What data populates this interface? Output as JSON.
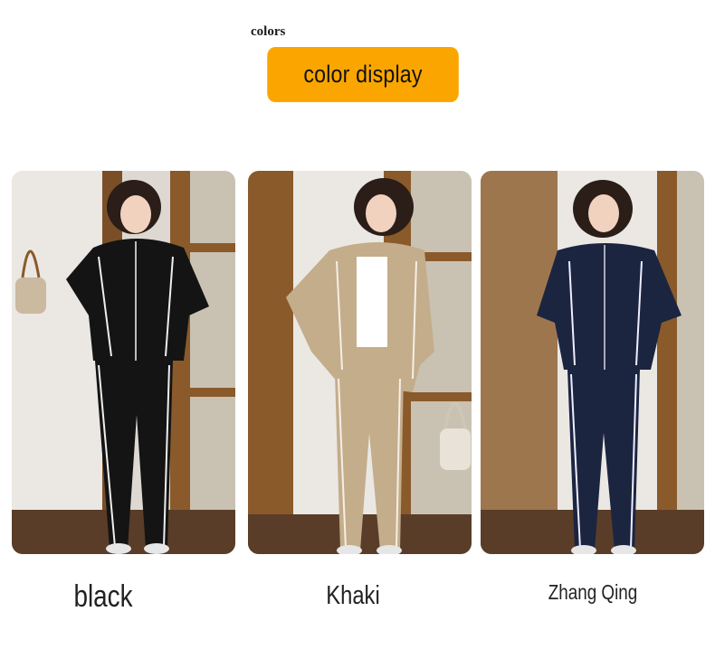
{
  "header": {
    "section_label": "colors",
    "banner_text": "color display"
  },
  "colors": {
    "banner": "#fba600",
    "black_outfit": "#141414",
    "khaki_outfit": "#c4ad8b",
    "navy_outfit": "#1b2540",
    "wood": "#8a5a2b"
  },
  "products": [
    {
      "caption": "black"
    },
    {
      "caption": "Khaki"
    },
    {
      "caption": "Zhang Qing"
    }
  ]
}
